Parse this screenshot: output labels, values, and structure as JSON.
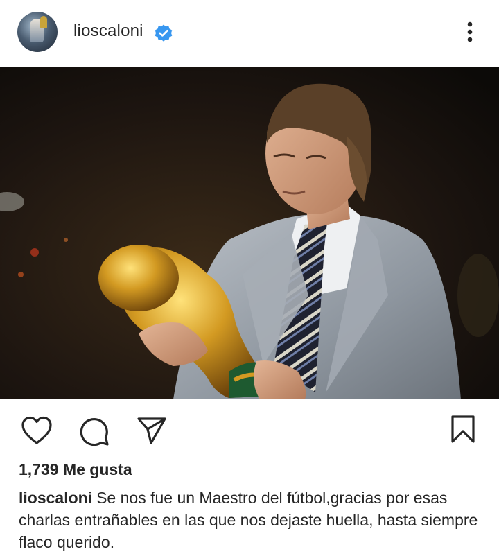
{
  "post": {
    "username": "lioscaloni",
    "verified": true,
    "likes_text": "1,739 Me gusta",
    "caption_username": "lioscaloni",
    "caption_text": "Se nos fue un Maestro del fútbol,gracias por esas charlas entrañables en las que nos dejaste huella, hasta siempre flaco querido."
  },
  "icons": {
    "more": "more-vertical-icon",
    "like": "heart-icon",
    "comment": "comment-icon",
    "share": "send-icon",
    "save": "bookmark-icon",
    "verified": "verified-badge-icon"
  },
  "colors": {
    "text": "#262626",
    "verified_blue": "#3897f0",
    "background": "#ffffff"
  }
}
